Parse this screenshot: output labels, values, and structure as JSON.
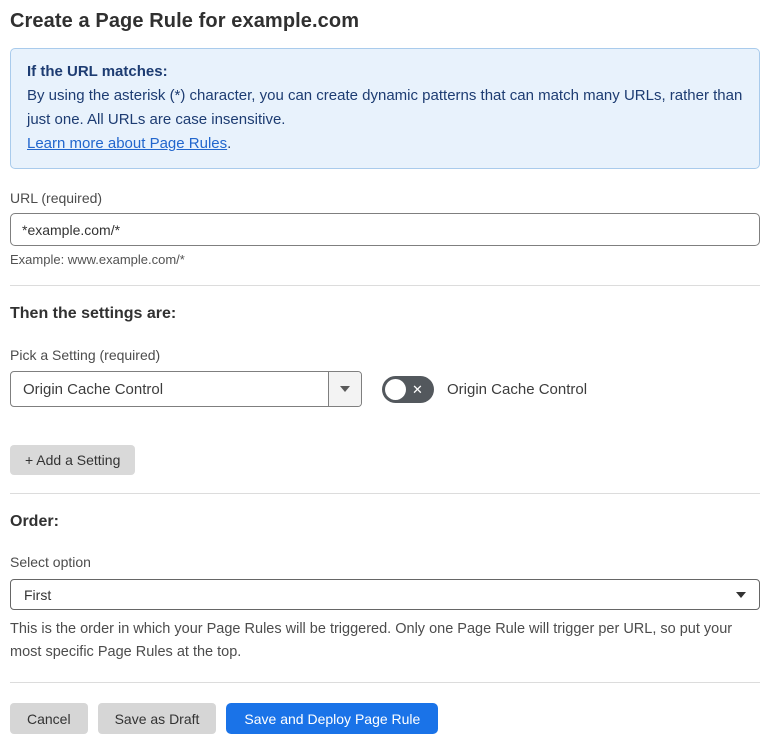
{
  "page": {
    "title": "Create a Page Rule for example.com"
  },
  "info_box": {
    "heading": "If the URL matches:",
    "body": "By using the asterisk (*) character, you can create dynamic patterns that can match many URLs, rather than just one. All URLs are case insensitive.",
    "link_label": "Learn more about Page Rules",
    "link_suffix": "."
  },
  "url_field": {
    "label": "URL (required)",
    "value": "*example.com/*",
    "hint": "Example: www.example.com/*"
  },
  "settings_section": {
    "heading": "Then the settings are:",
    "picker_label": "Pick a Setting (required)",
    "picker_value": "Origin Cache Control",
    "toggle_state": "off",
    "toggle_glyph": "✕",
    "toggle_label": "Origin Cache Control",
    "add_setting_label": "+ Add a Setting"
  },
  "order_section": {
    "heading": "Order:",
    "select_label": "Select option",
    "select_value": "First",
    "description": "This is the order in which your Page Rules will be triggered. Only one Page Rule will trigger per URL, so put your most specific Page Rules at the top."
  },
  "actions": {
    "cancel_label": "Cancel",
    "save_draft_label": "Save as Draft",
    "save_deploy_label": "Save and Deploy Page Rule"
  },
  "colors": {
    "info_background": "#e8f2fc",
    "info_border": "#a9cbec",
    "info_text": "#1d3c72",
    "link_blue": "#2166cd",
    "toggle_background": "#53585d",
    "gray_button": "#d6d6d6",
    "primary_blue": "#1a73e8"
  }
}
